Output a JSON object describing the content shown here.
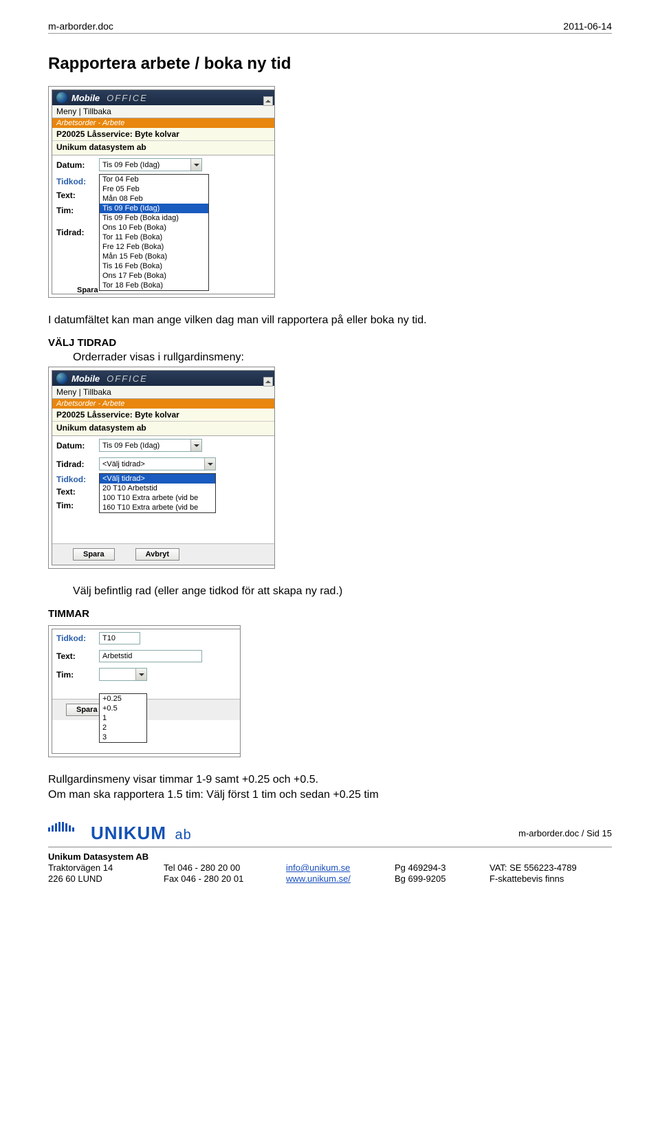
{
  "header": {
    "docname": "m-arborder.doc",
    "date": "2011-06-14"
  },
  "title": "Rapportera arbete / boka ny tid",
  "intro": "I datumfältet kan man ange vilken dag man vill rapportera på eller boka ny tid.",
  "mobileoffice": {
    "brand_mobile": "Mobile",
    "brand_office": "OFFICE",
    "nav": "Meny | Tillbaka",
    "orange": "Arbetsorder - Arbete",
    "jobline": "P20025 Låsservice: Byte kolvar",
    "company": "Unikum datasystem ab",
    "labels": {
      "datum": "Datum:",
      "tidrad": "Tidrad:",
      "tidkod": "Tidkod:",
      "text": "Text:",
      "tim": "Tim:"
    },
    "datum_value": "Tis 09 Feb (Idag)",
    "datum_options": [
      "Tor 04 Feb",
      "Fre 05 Feb",
      "Mån 08 Feb",
      "Tis 09 Feb (Idag)",
      "Tis 09 Feb (Boka idag)",
      "Ons 10 Feb (Boka)",
      "Tor 11 Feb (Boka)",
      "Fre 12 Feb (Boka)",
      "Mån 15 Feb (Boka)",
      "Tis 16 Feb (Boka)",
      "Ons 17 Feb (Boka)",
      "Tor 18 Feb (Boka)"
    ],
    "datum_selected": "Tis 09 Feb (Idag)",
    "tidrad_value": "<Välj tidrad>",
    "tidrad_options": [
      "<Välj tidrad>",
      "20 T10 Arbetstid",
      "100 T10 Extra arbete (vid be",
      "160 T10 Extra arbete (vid be"
    ],
    "tidrad_selected": "<Välj tidrad>",
    "spara": "Spara",
    "avbryt": "Avbryt",
    "spar_truncated": "Spara"
  },
  "section2": {
    "heading": "VÄLJ TIDRAD",
    "text": "Orderrader visas i rullgardinsmeny:",
    "aftertext": "Välj befintlig rad (eller ange tidkod för att skapa ny rad.)"
  },
  "section3": {
    "heading": "TIMMAR",
    "tidkod_value": "T10",
    "text_value": "Arbetstid",
    "tim_options": [
      "+0.25",
      "+0.5",
      "1",
      "2",
      "3"
    ],
    "after1": "Rullgardinsmeny visar timmar  1-9 samt +0.25 och +0.5.",
    "after2": "Om man ska rapportera 1.5 tim: Välj först 1 tim och sedan +0.25 tim",
    "spara_label": "Spara"
  },
  "footer": {
    "pageref": "m-arborder.doc / Sid 15",
    "company": "Unikum Datasystem AB",
    "col1a": "Traktorvägen 14",
    "col1b": "226 60  LUND",
    "col2a": "Tel  046 - 280 20 00",
    "col2b": "Fax  046 - 280 20 01",
    "col3a": "info@unikum.se",
    "col3b": "www.unikum.se/",
    "col4a": "Pg  469294-3",
    "col4b": "Bg  699-9205",
    "col5a": "VAT: SE 556223-4789",
    "col5b": "F-skattebevis finns"
  }
}
